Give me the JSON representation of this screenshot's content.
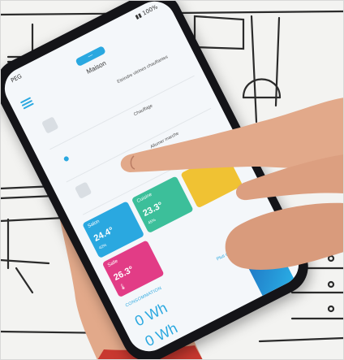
{
  "image": {
    "description_kind": "photo",
    "colors": {
      "background": "#f3f3f1",
      "sketch_line": "#2b2b2b",
      "phone_body": "#141418",
      "screen_bg": "#f4f7fa",
      "accent": "#2aa8e0",
      "skin": "#e2a98a",
      "sleeve": "#c8382f"
    }
  },
  "phone": {
    "status_left": "PEG",
    "status_right": "▮▮ 100%",
    "logo_text": "—",
    "header_title": "Maison",
    "devices": [
      {
        "icon": "thermostat-icon",
        "label": "Eteindre vitrines chauffantes"
      },
      {
        "icon": "dot-icon",
        "label": "Chauffage"
      },
      {
        "icon": "outlet-icon",
        "label": "Allumer marche"
      }
    ],
    "tiles": [
      {
        "name": "Salon",
        "temp": "24.4°",
        "hum": "42%",
        "color": "#2aa8e0"
      },
      {
        "name": "Cuisine",
        "temp": "23.3°",
        "hum": "45%",
        "color": "#3cbf9a"
      },
      {
        "name": "",
        "temp": "",
        "hum": "",
        "color": "#f0c233"
      },
      {
        "name": "Salle",
        "temp": "26.3°",
        "hum": "",
        "color": "#e23c86"
      }
    ],
    "section_label": "CONSOMMATION",
    "section_link": "Plus de détails",
    "consumption": [
      {
        "value": "0 Wh",
        "sub": ""
      },
      {
        "value": "0 Wh",
        "sub": ""
      }
    ]
  }
}
